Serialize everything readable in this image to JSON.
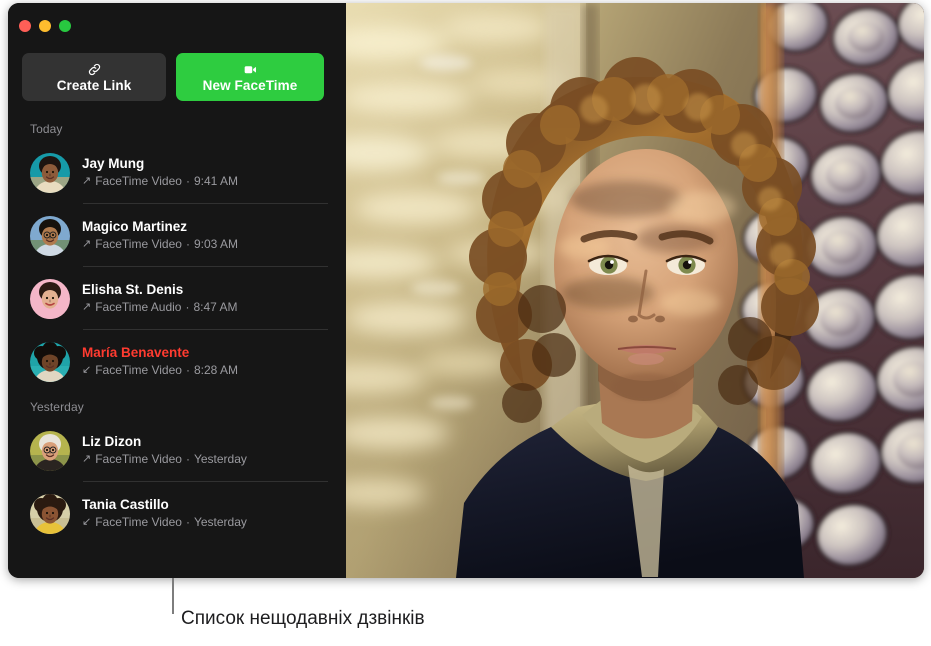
{
  "window": {
    "traffic_lights": [
      {
        "name": "close-button",
        "color": "#ff5f57"
      },
      {
        "name": "minimize-button",
        "color": "#febc2e"
      },
      {
        "name": "maximize-button",
        "color": "#28c840"
      }
    ]
  },
  "toolbar": {
    "create_link": {
      "label": "Create Link",
      "icon": "link-icon",
      "bg": "#333333"
    },
    "new_facetime": {
      "label": "New FaceTime",
      "icon": "video-camera-icon",
      "bg": "#2ecc40"
    }
  },
  "sidebar": {
    "sections": [
      {
        "header": "Today",
        "calls": [
          {
            "name": "Jay Mung",
            "type": "FaceTime Video",
            "time": "9:41 AM",
            "direction": "outgoing",
            "arrow": "↗",
            "missed": false,
            "separator": " · ",
            "avatar": "avatar-jay-mung"
          },
          {
            "name": "Magico Martinez",
            "type": "FaceTime Video",
            "time": "9:03 AM",
            "direction": "outgoing",
            "arrow": "↗",
            "missed": false,
            "separator": " · ",
            "avatar": "avatar-magico-martinez"
          },
          {
            "name": "Elisha St. Denis",
            "type": "FaceTime Audio",
            "time": "8:47 AM",
            "direction": "outgoing",
            "arrow": "↗",
            "missed": false,
            "separator": " · ",
            "avatar": "avatar-elisha-st-denis"
          },
          {
            "name": "María Benavente",
            "type": "FaceTime Video",
            "time": "8:28 AM",
            "direction": "incoming",
            "arrow": "↙",
            "missed": true,
            "separator": " · ",
            "avatar": "avatar-maria-benavente"
          }
        ]
      },
      {
        "header": "Yesterday",
        "calls": [
          {
            "name": "Liz Dizon",
            "type": "FaceTime Video",
            "time": "Yesterday",
            "direction": "outgoing",
            "arrow": "↗",
            "missed": false,
            "separator": " · ",
            "avatar": "avatar-liz-dizon"
          },
          {
            "name": "Tania Castillo",
            "type": "FaceTime Video",
            "time": "Yesterday",
            "direction": "incoming",
            "arrow": "↙",
            "missed": false,
            "separator": " · ",
            "avatar": "avatar-tania-castillo"
          }
        ]
      }
    ]
  },
  "video": {
    "description": "active-facetime-video-participant"
  },
  "callout": {
    "label": "Список нещодавніх дзвінків"
  },
  "colors": {
    "missed_red": "#ff3b30",
    "accent_green": "#2ecc40",
    "sidebar_bg": "#161616",
    "secondary_text": "#9a9a9f"
  }
}
